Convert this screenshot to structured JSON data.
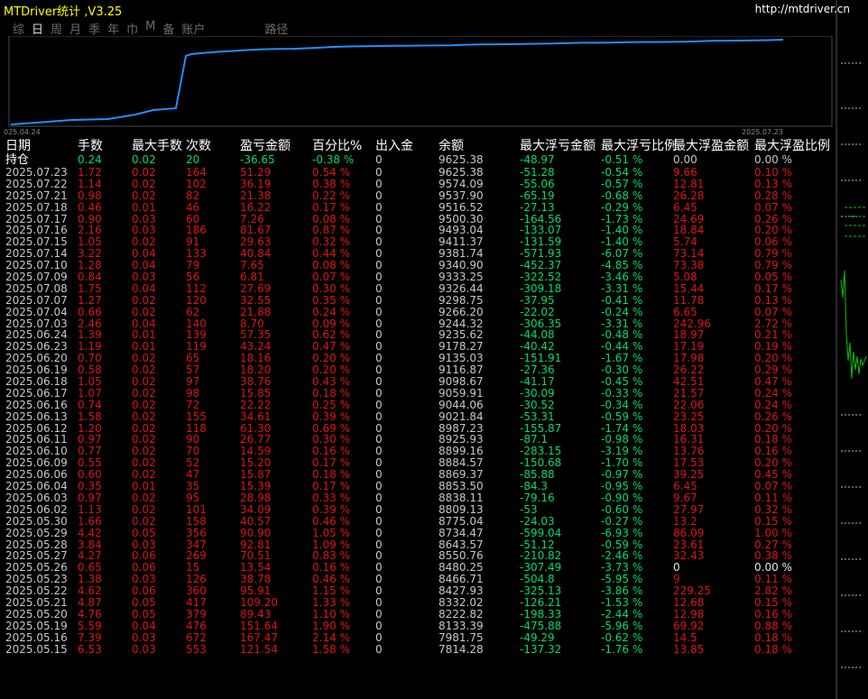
{
  "app_title": "MTDriver统计 ,V3.25",
  "url": "http://mtdriver.cn",
  "tabs": [
    "综",
    "日",
    "周",
    "月",
    "季",
    "年",
    "巾",
    "M",
    "备",
    "账户",
    "路径"
  ],
  "active_tab": "日",
  "colors": {
    "accent": "#ffff00",
    "line": "#1e90ff",
    "red": "#dc1414",
    "green": "#00dc64",
    "muted": "#c8c8c8"
  },
  "chart_data": {
    "type": "line",
    "x_start_label": "025.04.24",
    "x_end_label": "2025.07.23",
    "values": [
      7814.28,
      7981.75,
      8133.39,
      8222.82,
      8332.02,
      8427.93,
      8466.71,
      8480.25,
      8550.76,
      8643.57,
      8734.47,
      8775.04,
      8809.13,
      8838.11,
      8853.5,
      8869.37,
      8884.57,
      8899.16,
      8925.93,
      8987.23,
      9021.84,
      9044.06,
      9059.91,
      9098.67,
      9116.87,
      9135.03,
      9178.27,
      9235.62,
      9244.32,
      9266.2,
      9298.75,
      9326.44,
      9333.25,
      9340.9,
      9381.74,
      9411.37,
      9493.04,
      9500.3,
      9516.52,
      9537.9,
      9574.09,
      9625.38
    ]
  },
  "header": {
    "date": "日期",
    "lots": "手数",
    "max_lots": "最大手数",
    "count": "次数",
    "pnl": "盈亏金额",
    "pct": "百分比%",
    "io": "出入金",
    "balance": "余额",
    "max_float_loss": "最大浮亏金额",
    "max_float_loss_pct": "最大浮亏比例",
    "max_float_profit": "最大浮盈金额",
    "max_float_profit_pct": "最大浮盈比例"
  },
  "holding": {
    "label": "持仓",
    "lots": "0.24",
    "max_lots": "0.02",
    "count": "20",
    "pnl": "-36.65",
    "pct": "-0.38 %",
    "io": "0",
    "balance": "9625.38",
    "mfl": "-48.97",
    "mflp": "-0.51 %",
    "mfp": "0.00",
    "mfpp": "0.00 %"
  },
  "rows": [
    [
      "2025.07.23",
      "1.72",
      "0.02",
      "164",
      "51.29",
      "0.54 %",
      "0",
      "9625.38",
      "-51.28",
      "-0.54 %",
      "9.66",
      "0.10 %"
    ],
    [
      "2025.07.22",
      "1.14",
      "0.02",
      "102",
      "36.19",
      "0.38 %",
      "0",
      "9574.09",
      "-55.06",
      "-0.57 %",
      "12.81",
      "0.13 %"
    ],
    [
      "2025.07.21",
      "0.98",
      "0.02",
      "82",
      "21.38",
      "0.22 %",
      "0",
      "9537.90",
      "-65.19",
      "-0.68 %",
      "26.28",
      "0.28 %"
    ],
    [
      "2025.07.18",
      "0.46",
      "0.01",
      "46",
      "16.22",
      "0.17 %",
      "0",
      "9516.52",
      "-27.13",
      "-0.29 %",
      "6.45",
      "0.07 %"
    ],
    [
      "2025.07.17",
      "0.90",
      "0.03",
      "60",
      "7.26",
      "0.08 %",
      "0",
      "9500.30",
      "-164.56",
      "-1.73 %",
      "24.69",
      "0.26 %"
    ],
    [
      "2025.07.16",
      "2.16",
      "0.03",
      "186",
      "81.67",
      "0.87 %",
      "0",
      "9493.04",
      "-133.07",
      "-1.40 %",
      "18.84",
      "0.20 %"
    ],
    [
      "2025.07.15",
      "1.05",
      "0.02",
      "91",
      "29.63",
      "0.32 %",
      "0",
      "9411.37",
      "-131.59",
      "-1.40 %",
      "5.74",
      "0.06 %"
    ],
    [
      "2025.07.14",
      "3.22",
      "0.04",
      "133",
      "40.84",
      "0.44 %",
      "0",
      "9381.74",
      "-571.93",
      "-6.07 %",
      "73.14",
      "0.79 %"
    ],
    [
      "2025.07.10",
      "1.28",
      "0.04",
      "79",
      "7.65",
      "0.08 %",
      "0",
      "9340.90",
      "-452.37",
      "-4.85 %",
      "73.38",
      "0.79 %"
    ],
    [
      "2025.07.09",
      "0.84",
      "0.03",
      "56",
      "6.81",
      "0.07 %",
      "0",
      "9333.25",
      "-322.52",
      "-3.46 %",
      "5.08",
      "0.05 %"
    ],
    [
      "2025.07.08",
      "1.75",
      "0.04",
      "112",
      "27.69",
      "0.30 %",
      "0",
      "9326.44",
      "-309.18",
      "-3.31 %",
      "15.44",
      "0.17 %"
    ],
    [
      "2025.07.07",
      "1.27",
      "0.02",
      "120",
      "32.55",
      "0.35 %",
      "0",
      "9298.75",
      "-37.95",
      "-0.41 %",
      "11.78",
      "0.13 %"
    ],
    [
      "2025.07.04",
      "0.66",
      "0.02",
      "62",
      "21.88",
      "0.24 %",
      "0",
      "9266.20",
      "-22.02",
      "-0.24 %",
      "6.65",
      "0.07 %"
    ],
    [
      "2025.07.03",
      "2.46",
      "0.04",
      "140",
      "8.70",
      "0.09 %",
      "0",
      "9244.32",
      "-306.35",
      "-3.31 %",
      "242.96",
      "2.72 %"
    ],
    [
      "2025.06.24",
      "1.39",
      "0.01",
      "139",
      "57.35",
      "0.62 %",
      "0",
      "9235.62",
      "-44.08",
      "-0.48 %",
      "18.97",
      "0.21 %"
    ],
    [
      "2025.06.23",
      "1.19",
      "0.01",
      "119",
      "43.24",
      "0.47 %",
      "0",
      "9178.27",
      "-40.42",
      "-0.44 %",
      "17.19",
      "0.19 %"
    ],
    [
      "2025.06.20",
      "0.70",
      "0.02",
      "65",
      "18.16",
      "0.20 %",
      "0",
      "9135.03",
      "-151.91",
      "-1.67 %",
      "17.98",
      "0.20 %"
    ],
    [
      "2025.06.19",
      "0.58",
      "0.02",
      "57",
      "18.20",
      "0.20 %",
      "0",
      "9116.87",
      "-27.36",
      "-0.30 %",
      "26.22",
      "0.29 %"
    ],
    [
      "2025.06.18",
      "1.05",
      "0.02",
      "97",
      "38.76",
      "0.43 %",
      "0",
      "9098.67",
      "-41.17",
      "-0.45 %",
      "42.51",
      "0.47 %"
    ],
    [
      "2025.06.17",
      "1.07",
      "0.02",
      "98",
      "15.85",
      "0.18 %",
      "0",
      "9059.91",
      "-30.09",
      "-0.33 %",
      "21.57",
      "0.24 %"
    ],
    [
      "2025.06.16",
      "0.74",
      "0.02",
      "72",
      "22.22",
      "0.25 %",
      "0",
      "9044.06",
      "-30.52",
      "-0.34 %",
      "22.06",
      "0.24 %"
    ],
    [
      "2025.06.13",
      "1.58",
      "0.02",
      "155",
      "34.61",
      "0.39 %",
      "0",
      "9021.84",
      "-53.31",
      "-0.59 %",
      "23.25",
      "0.26 %"
    ],
    [
      "2025.06.12",
      "1.20",
      "0.02",
      "118",
      "61.30",
      "0.69 %",
      "0",
      "8987.23",
      "-155.87",
      "-1.74 %",
      "18.03",
      "0.20 %"
    ],
    [
      "2025.06.11",
      "0.97",
      "0.02",
      "90",
      "26.77",
      "0.30 %",
      "0",
      "8925.93",
      "-87.1",
      "-0.98 %",
      "16.31",
      "0.18 %"
    ],
    [
      "2025.06.10",
      "0.77",
      "0.02",
      "70",
      "14.59",
      "0.16 %",
      "0",
      "8899.16",
      "-283.15",
      "-3.19 %",
      "13.76",
      "0.16 %"
    ],
    [
      "2025.06.09",
      "0.55",
      "0.02",
      "52",
      "15.20",
      "0.17 %",
      "0",
      "8884.57",
      "-150.68",
      "-1.70 %",
      "17.53",
      "0.20 %"
    ],
    [
      "2025.06.06",
      "0.60",
      "0.02",
      "47",
      "15.87",
      "0.18 %",
      "0",
      "8869.37",
      "-85.88",
      "-0.97 %",
      "39.25",
      "0.45 %"
    ],
    [
      "2025.06.04",
      "0.35",
      "0.01",
      "35",
      "15.39",
      "0.17 %",
      "0",
      "8853.50",
      "-84.3",
      "-0.95 %",
      "6.45",
      "0.07 %"
    ],
    [
      "2025.06.03",
      "0.97",
      "0.02",
      "95",
      "28.98",
      "0.33 %",
      "0",
      "8838.11",
      "-79.16",
      "-0.90 %",
      "9.67",
      "0.11 %"
    ],
    [
      "2025.06.02",
      "1.13",
      "0.02",
      "101",
      "34.09",
      "0.39 %",
      "0",
      "8809.13",
      "-53",
      "-0.60 %",
      "27.97",
      "0.32 %"
    ],
    [
      "2025.05.30",
      "1.66",
      "0.02",
      "158",
      "40.57",
      "0.46 %",
      "0",
      "8775.04",
      "-24.03",
      "-0.27 %",
      "13.2",
      "0.15 %"
    ],
    [
      "2025.05.29",
      "4.42",
      "0.05",
      "356",
      "90.90",
      "1.05 %",
      "0",
      "8734.47",
      "-599.04",
      "-6.93 %",
      "86.09",
      "1.00 %"
    ],
    [
      "2025.05.28",
      "3.84",
      "0.03",
      "347",
      "92.81",
      "1.09 %",
      "0",
      "8643.57",
      "-51.12",
      "-0.59 %",
      "23.61",
      "0.27 %"
    ],
    [
      "2025.05.27",
      "4.27",
      "0.06",
      "269",
      "70.51",
      "0.83 %",
      "0",
      "8550.76",
      "-210.82",
      "-2.46 %",
      "32.43",
      "0.38 %"
    ],
    [
      "2025.05.26",
      "0.65",
      "0.06",
      "15",
      "13.54",
      "0.16 %",
      "0",
      "8480.25",
      "-307.49",
      "-3.73 %",
      "0",
      "0.00 %"
    ],
    [
      "2025.05.23",
      "1.38",
      "0.03",
      "126",
      "38.78",
      "0.46 %",
      "0",
      "8466.71",
      "-504.8",
      "-5.95 %",
      "9",
      "0.11 %"
    ],
    [
      "2025.05.22",
      "4.62",
      "0.06",
      "360",
      "95.91",
      "1.15 %",
      "0",
      "8427.93",
      "-325.13",
      "-3.86 %",
      "229.25",
      "2.82 %"
    ],
    [
      "2025.05.21",
      "4.87",
      "0.05",
      "417",
      "109.20",
      "1.33 %",
      "0",
      "8332.02",
      "-126.21",
      "-1.53 %",
      "12.68",
      "0.15 %"
    ],
    [
      "2025.05.20",
      "4.76",
      "0.05",
      "379",
      "89.43",
      "1.10 %",
      "0",
      "8222.82",
      "-198.33",
      "-2.44 %",
      "12.98",
      "0.16 %"
    ],
    [
      "2025.05.19",
      "5.59",
      "0.04",
      "476",
      "151.64",
      "1.90 %",
      "0",
      "8133.39",
      "-475.88",
      "-5.96 %",
      "69.92",
      "0.88 %"
    ],
    [
      "2025.05.16",
      "7.39",
      "0.03",
      "672",
      "167.47",
      "2.14 %",
      "0",
      "7981.75",
      "-49.29",
      "-0.62 %",
      "14.5",
      "0.18 %"
    ],
    [
      "2025.05.15",
      "6.53",
      "0.03",
      "553",
      "121.54",
      "1.58 %",
      "0",
      "7814.28",
      "-137.32",
      "-1.76 %",
      "13.85",
      "0.18 %"
    ]
  ]
}
